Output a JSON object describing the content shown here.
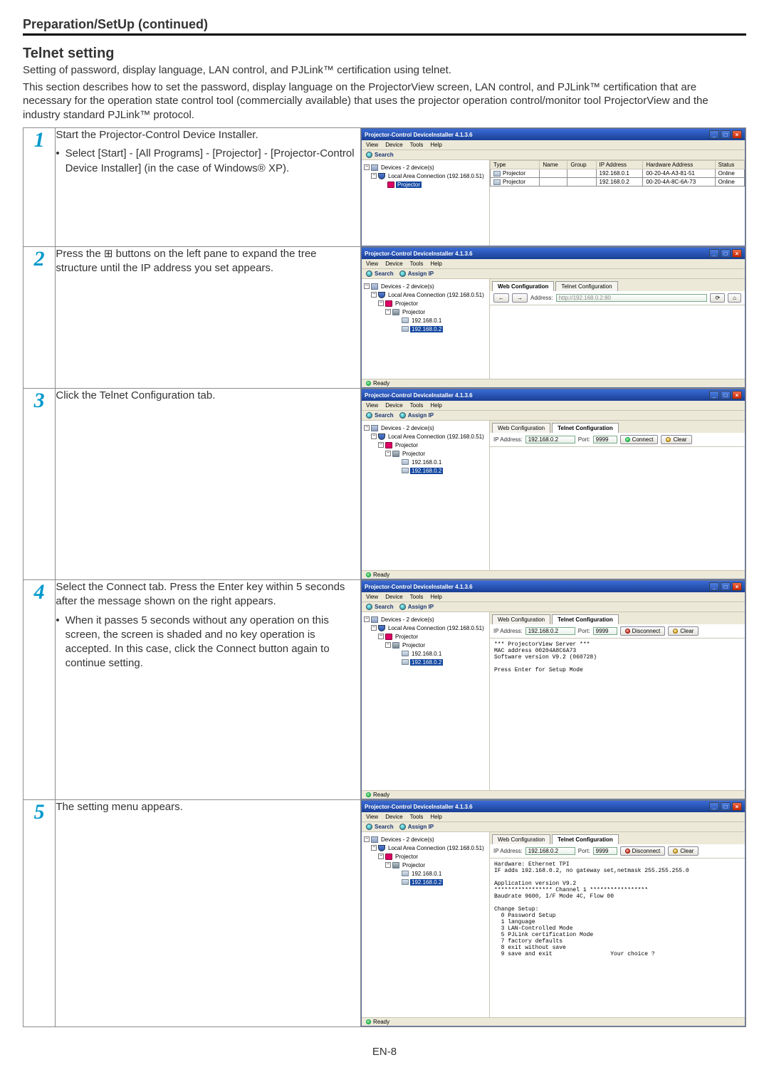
{
  "header": {
    "section_title": "Preparation/SetUp (continued)",
    "subhead": "Telnet setting",
    "intro1": "Setting of password, display language, LAN control, and PJLink™ certification using telnet.",
    "intro2": "This section describes how to set the password, display language on the ProjectorView screen, LAN control, and PJLink™ certification that are necessary for the operation state control tool (commercially available) that uses the projector operation control/monitor tool ProjectorView and the industry standard PJLink™ protocol."
  },
  "footer": {
    "page": "EN-8"
  },
  "window": {
    "title": "Projector-Control DeviceInstaller 4.1.3.6",
    "menu": {
      "view": "View",
      "device": "Device",
      "tools": "Tools",
      "help": "Help"
    },
    "toolbar": {
      "search": "Search",
      "assign_ip": "Assign IP"
    },
    "winbtn": {
      "min": "_",
      "max": "□",
      "close": "×"
    },
    "tree": {
      "root": "Devices - 2 device(s)",
      "lan": "Local Area Connection (192.168.0.51)",
      "proj1": "Projector",
      "proj2": "Projector",
      "ip1": "192.168.0.1",
      "ip2": "192.168.0.2",
      "pm_minus": "−",
      "pm_plus": "+"
    },
    "list_headers": {
      "type": "Type",
      "name": "Name",
      "group": "Group",
      "ip": "IP Address",
      "hw": "Hardware Address",
      "status": "Status"
    },
    "list_rows": [
      {
        "type": "Projector",
        "name": "",
        "group": "",
        "ip": "192.168.0.1",
        "hw": "00-20-4A-A3-81-51",
        "status": "Online"
      },
      {
        "type": "Projector",
        "name": "",
        "group": "",
        "ip": "192.168.0.2",
        "hw": "00-20-4A-8C-6A-73",
        "status": "Online"
      }
    ],
    "tabs": {
      "web": "Web Configuration",
      "telnet": "Telnet Configuration"
    },
    "ctrls": {
      "ip_label": "IP Address:",
      "ip": "192.168.0.2",
      "port_label": "Port:",
      "port": "9999",
      "connect": "Connect",
      "disconnect": "Disconnect",
      "clear": "Clear",
      "addr_label": "Address:",
      "addr_url": "http://192.168.0.2:80"
    },
    "webbar_icons": {
      "back": "←",
      "fwd": "→",
      "refresh": "⟳",
      "home": "⌂"
    },
    "status": {
      "ready": "Ready"
    },
    "console_step4": "*** ProjectorView Server ***\nMAC address 00204A8C6A73\nSoftware version V9.2 (060728)\n\nPress Enter for Setup Mode",
    "console_step5": "Hardware: Ethernet TPI\nIF adds 192.168.0.2, no gateway set,netmask 255.255.255.0\n\nApplication version V9.2\n***************** Channel 1 *****************\nBaudrate 9600, I/F Mode 4C, Flow 00\n\nChange Setup:\n  0 Password Setup\n  1 language\n  3 LAN-Controlled Mode\n  5 PJLink certification Mode\n  7 factory defaults\n  8 exit without save\n  9 save and exit                 Your choice ? "
  },
  "steps": [
    {
      "n": "1",
      "text": "Start the Projector-Control Device Installer.",
      "bullet": "Select [Start] - [All Programs] - [Projector] - [Projector-Control Device Installer] (in the case of Windows® XP)."
    },
    {
      "n": "2",
      "text": "Press the ⊞ buttons on the left pane to expand the tree structure until the IP address you set appears."
    },
    {
      "n": "3",
      "text": "Click the Telnet Configuration tab."
    },
    {
      "n": "4",
      "text": "Select the Connect tab. Press the Enter key within 5 seconds after the message shown on the right appears.",
      "bullet": "When it passes 5 seconds without any operation on this screen, the screen is shaded and no key operation is accepted. In this case, click the Connect button again to continue setting."
    },
    {
      "n": "5",
      "text": "The setting menu appears."
    }
  ]
}
